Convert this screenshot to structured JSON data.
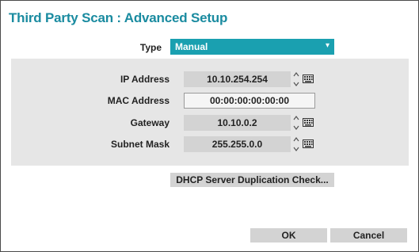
{
  "dialog": {
    "title": "Third Party Scan : Advanced Setup"
  },
  "type_field": {
    "label": "Type",
    "value": "Manual"
  },
  "fields": {
    "ip": {
      "label": "IP Address",
      "value": "10.10.254.254"
    },
    "mac": {
      "label": "MAC Address",
      "value": "00:00:00:00:00:00"
    },
    "gateway": {
      "label": "Gateway",
      "value": "10.10.0.2"
    },
    "subnet": {
      "label": "Subnet Mask",
      "value": "255.255.0.0"
    }
  },
  "buttons": {
    "dhcp_check": "DHCP Server Duplication Check...",
    "ok": "OK",
    "cancel": "Cancel"
  },
  "icons": {
    "dropdown": "chevron-down-icon",
    "spinner": "spin-arrows-icon",
    "keyboard": "keyboard-icon"
  },
  "colors": {
    "accent": "#1aa0b0",
    "title": "#1a8ba0",
    "panel": "#e6e6e6",
    "field": "#d3d3d3"
  }
}
